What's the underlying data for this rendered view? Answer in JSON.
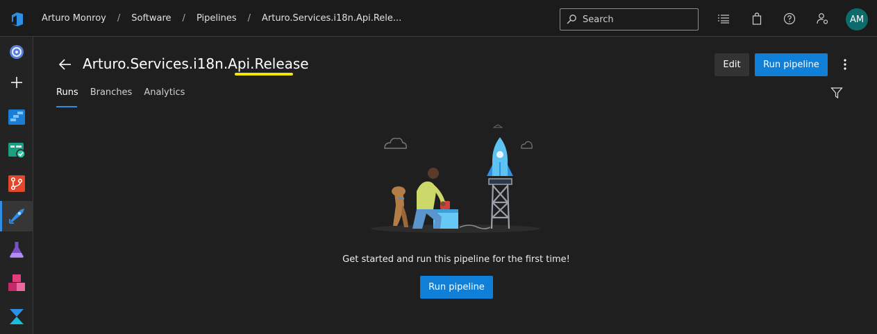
{
  "header": {
    "breadcrumbs": [
      "Arturo Monroy",
      "Software",
      "Pipelines",
      "Arturo.Services.i18n.Api.Rele..."
    ],
    "separator": "/",
    "search": {
      "placeholder": "Search"
    },
    "avatar_initials": "AM",
    "icons": [
      "list-icon",
      "shopping-bag-icon",
      "help-icon",
      "user-settings-icon"
    ]
  },
  "sidebar": {
    "items": [
      {
        "name": "overview-icon"
      },
      {
        "name": "add-icon"
      },
      {
        "name": "boards-icon"
      },
      {
        "name": "test-plans-icon"
      },
      {
        "name": "repos-icon"
      },
      {
        "name": "pipelines-icon",
        "active": true
      },
      {
        "name": "flask-icon"
      },
      {
        "name": "artifacts-icon"
      },
      {
        "name": "zone-icon"
      }
    ]
  },
  "page": {
    "title": "Arturo.Services.i18n.Api.Release",
    "edit_label": "Edit",
    "run_label": "Run pipeline",
    "tabs": [
      {
        "label": "Runs",
        "active": true
      },
      {
        "label": "Branches"
      },
      {
        "label": "Analytics"
      }
    ],
    "empty_message": "Get started and run this pipeline for the first time!",
    "empty_button": "Run pipeline"
  },
  "colors": {
    "accent": "#0f7fd8",
    "highlight": "#f3e600",
    "avatar": "#0d6b6b"
  }
}
